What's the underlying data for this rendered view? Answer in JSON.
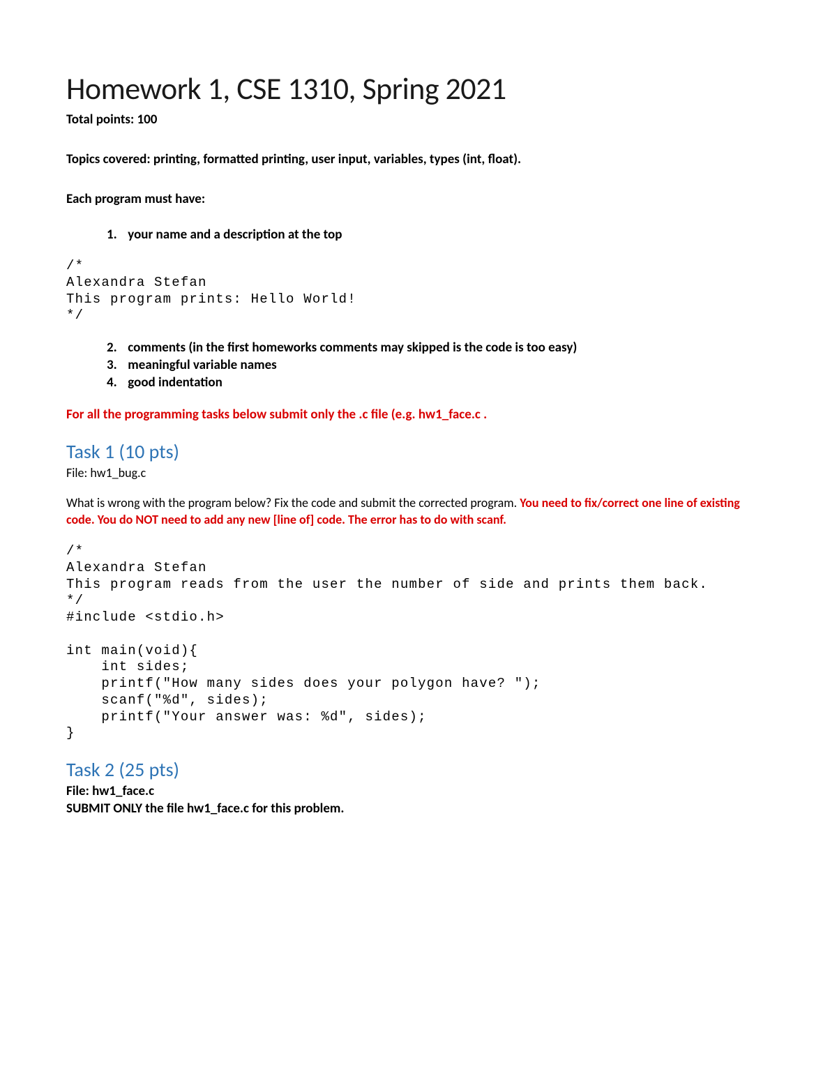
{
  "title": "Homework 1, CSE 1310, Spring 2021",
  "total_points": "Total points: 100",
  "topics": "Topics covered: printing, formatted printing, user input, variables, types (int, float).",
  "must_have_intro": "Each program must have:",
  "requirements": {
    "r1_num": "1.",
    "r1": "your name and a description at the top",
    "r2_num": "2.",
    "r2": "comments (in the first homeworks comments may skipped is the code is too easy)",
    "r3_num": "3.",
    "r3": "meaningful variable names",
    "r4_num": "4.",
    "r4": "good indentation"
  },
  "code_comment_1": "/*\nAlexandra Stefan\nThis program prints: Hello World!\n*/",
  "submit_notice": "For all the programming tasks below submit only the .c file (e.g. hw1_face.c .",
  "task1": {
    "heading": "Task 1 (10 pts)",
    "file": "File: hw1_bug.c",
    "desc_plain": "What is wrong with the program below? Fix the code and submit the corrected program. ",
    "desc_red": "You need to fix/correct one line of existing code. You do NOT need to add any new [line of] code. The error has to do with scanf.",
    "code": "/*\nAlexandra Stefan\nThis program reads from the user the number of side and prints them back.\n*/\n#include <stdio.h>\n\nint main(void){\n    int sides;\n    printf(\"How many sides does your polygon have? \");\n    scanf(\"%d\", sides);\n    printf(\"Your answer was: %d\", sides);\n}"
  },
  "task2": {
    "heading": "Task 2 (25 pts)",
    "file": "File: hw1_face.c",
    "submit": "SUBMIT ONLY the file hw1_face.c for this problem."
  }
}
